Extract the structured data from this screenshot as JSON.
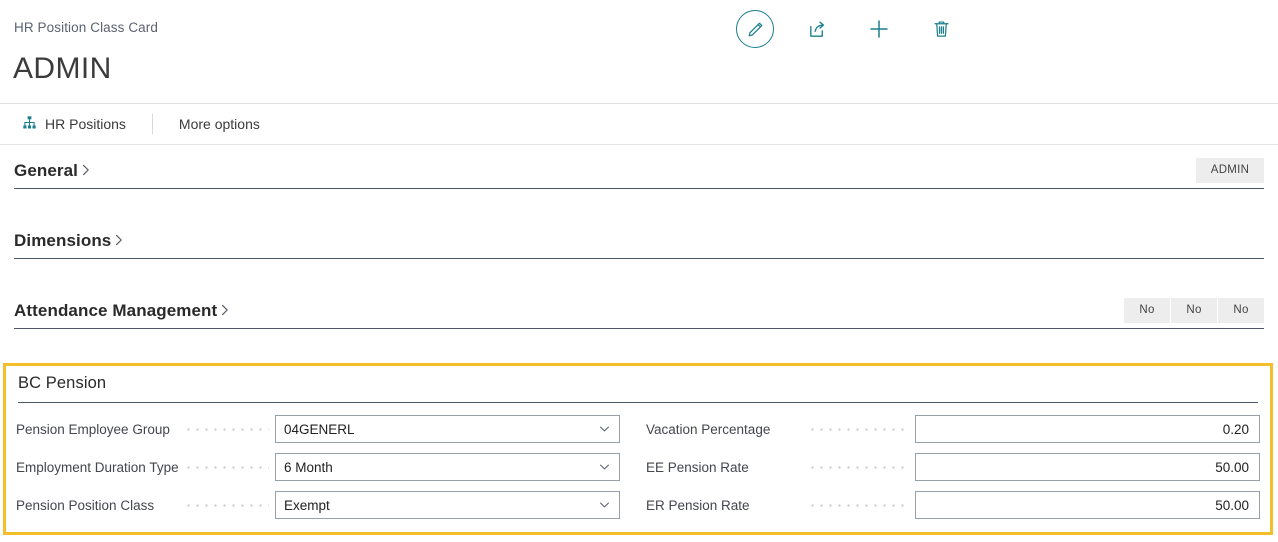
{
  "header": {
    "breadcrumb": "HR Position Class Card",
    "title": "ADMIN",
    "toolbar": [
      {
        "name": "edit-button",
        "label": "Edit",
        "icon": "pencil-icon"
      },
      {
        "name": "share-button",
        "label": "Share",
        "icon": "share-icon"
      },
      {
        "name": "new-button",
        "label": "New",
        "icon": "plus-icon"
      },
      {
        "name": "delete-button",
        "label": "Delete",
        "icon": "trash-icon"
      }
    ],
    "accent_color": "#1a7f8e"
  },
  "actionbar": {
    "hr_positions": "HR Positions",
    "more_options": "More options"
  },
  "sections": [
    {
      "key": "general",
      "title": "General",
      "badges": [
        {
          "text": "ADMIN",
          "wide": true
        }
      ]
    },
    {
      "key": "dimensions",
      "title": "Dimensions",
      "badges": []
    },
    {
      "key": "attendance_management",
      "title": "Attendance Management",
      "badges": [
        {
          "text": "No",
          "wide": false
        },
        {
          "text": "No",
          "wide": false
        },
        {
          "text": "No",
          "wide": false
        }
      ]
    }
  ],
  "pension": {
    "title": "BC Pension",
    "highlight_color": "#f4bf2b",
    "left_fields": [
      {
        "label": "Pension Employee Group",
        "value": "04GENERL",
        "type": "dropdown"
      },
      {
        "label": "Employment Duration Type",
        "value": "6 Month",
        "type": "dropdown"
      },
      {
        "label": "Pension Position Class",
        "value": "Exempt",
        "type": "dropdown"
      }
    ],
    "right_fields": [
      {
        "label": "Vacation Percentage",
        "value": "0.20",
        "type": "number"
      },
      {
        "label": "EE Pension Rate",
        "value": "50.00",
        "type": "number"
      },
      {
        "label": "ER Pension Rate",
        "value": "50.00",
        "type": "number"
      }
    ]
  }
}
